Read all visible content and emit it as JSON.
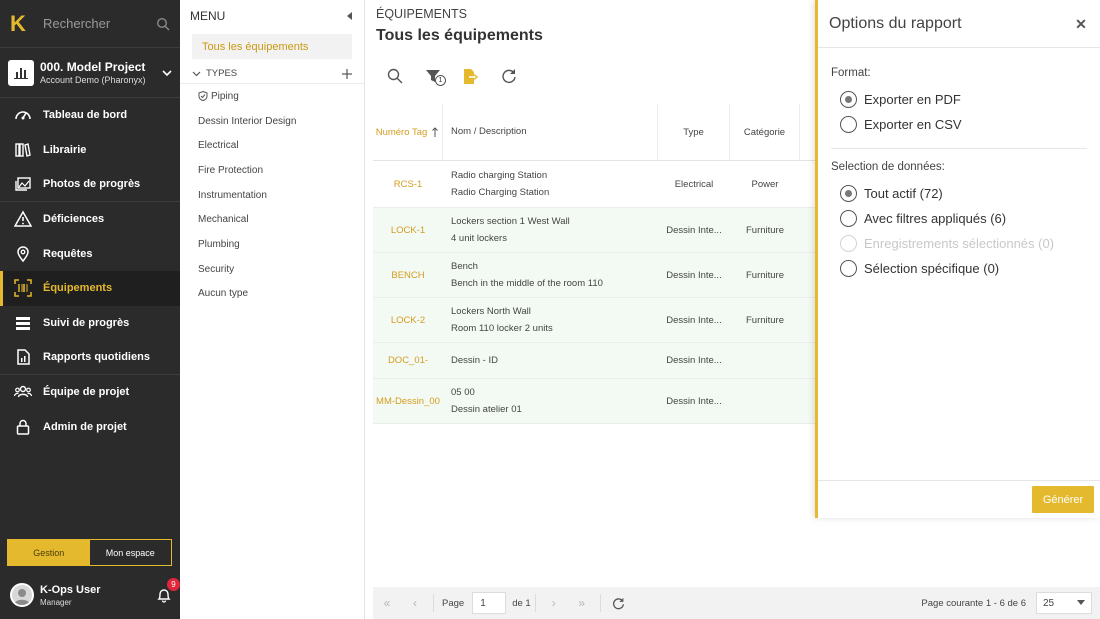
{
  "search": {
    "label": "Rechercher"
  },
  "project": {
    "name": "000. Model Project",
    "account": "Account Demo (Pharonyx)"
  },
  "nav": [
    {
      "label": "Tableau de bord",
      "icon": "speedometer-icon"
    },
    {
      "label": "Librairie",
      "icon": "library-icon"
    },
    {
      "label": "Photos de progrès",
      "icon": "photos-icon"
    },
    {
      "label": "Déficiences",
      "icon": "warning-icon"
    },
    {
      "label": "Requêtes",
      "icon": "location-pin-icon"
    },
    {
      "label": "Équipements",
      "icon": "barcode-scan-icon",
      "active": true
    },
    {
      "label": "Suivi de progrès",
      "icon": "progress-list-icon"
    },
    {
      "label": "Rapports quotidiens",
      "icon": "report-icon"
    },
    {
      "label": "Équipe de projet",
      "icon": "team-icon"
    },
    {
      "label": "Admin de projet",
      "icon": "lock-icon"
    }
  ],
  "mode": {
    "gestion": "Gestion",
    "espace": "Mon espace"
  },
  "user": {
    "name": "K-Ops User",
    "role": "Manager",
    "notifications": "9"
  },
  "menu": {
    "title": "MENU",
    "selected": "Tous les équipements",
    "types_label": "TYPES",
    "types": [
      "Piping",
      "Dessin Interior Design",
      "Electrical",
      "Fire Protection",
      "Instrumentation",
      "Mechanical",
      "Plumbing",
      "Security",
      "Aucun type"
    ]
  },
  "main": {
    "breadcrumb": "ÉQUIPEMENTS",
    "title": "Tous les équipements",
    "filter_count": "1",
    "columns": {
      "tag": "Numéro Tag",
      "name": "Nom / Description",
      "type": "Type",
      "category": "Catégorie"
    },
    "rows": [
      {
        "tag": "RCS-1",
        "name": "Radio charging Station",
        "desc": "Radio Charging Station",
        "type": "Electrical",
        "category": "Power"
      },
      {
        "tag": "LOCK-1",
        "name": "Lockers section 1 West Wall",
        "desc": "4 unit lockers",
        "type": "Dessin Inte...",
        "category": "Furniture"
      },
      {
        "tag": "BENCH",
        "name": "Bench",
        "desc": "Bench in the middle of the room 110",
        "type": "Dessin Inte...",
        "category": "Furniture"
      },
      {
        "tag": "LOCK-2",
        "name": "Lockers North Wall",
        "desc": "Room 110 locker 2 units",
        "type": "Dessin Inte...",
        "category": "Furniture"
      },
      {
        "tag": "DOC_01-",
        "name": "Dessin - ID",
        "desc": "",
        "type": "Dessin Inte...",
        "category": ""
      },
      {
        "tag": "MM-Dessin_00",
        "name": "05 00",
        "desc": "Dessin atelier 01",
        "type": "Dessin Inte...",
        "category": ""
      }
    ],
    "pager": {
      "page_label": "Page",
      "page": "1",
      "of": "de 1",
      "summary": "Page courante 1 - 6 de 6",
      "page_size": "25"
    }
  },
  "drawer": {
    "title": "Options du rapport",
    "format_label": "Format:",
    "formats": [
      {
        "label": "Exporter en PDF",
        "checked": true
      },
      {
        "label": "Exporter en CSV",
        "checked": false
      }
    ],
    "selection_label": "Selection de données:",
    "selections": [
      {
        "label": "Tout actif (72)",
        "checked": true,
        "disabled": false
      },
      {
        "label": "Avec filtres appliqués (6)",
        "checked": false,
        "disabled": false
      },
      {
        "label": "Enregistrements sélectionnés (0)",
        "checked": false,
        "disabled": true
      },
      {
        "label": "Sélection spécifique (0)",
        "checked": false,
        "disabled": false
      }
    ],
    "generate": "Générer"
  },
  "colors": {
    "accent": "#e5b92e",
    "sidebar": "#2b2b2b",
    "tag_text": "#d39c20",
    "row_alt": "#f3faf3"
  }
}
